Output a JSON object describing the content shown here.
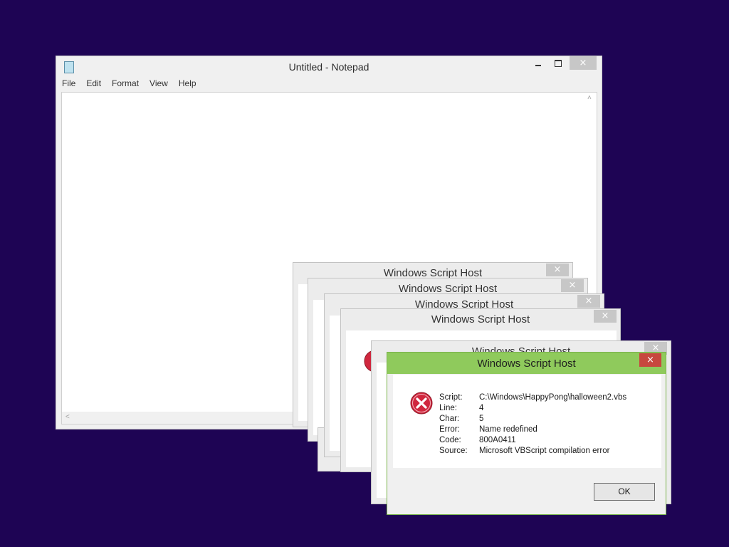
{
  "notepad": {
    "title": "Untitled - Notepad",
    "menu": [
      "File",
      "Edit",
      "Format",
      "View",
      "Help"
    ],
    "close_symbol": "×",
    "scroll_up_symbol": "˄",
    "scroll_left_symbol": "˂"
  },
  "background_windows": {
    "title": "Windows Script Host",
    "close_symbol": "×"
  },
  "error_dialog": {
    "title": "Windows Script Host",
    "close_symbol": "×",
    "icon": "error-icon",
    "fields": [
      {
        "label": "Script:",
        "value": "C:\\Windows\\HappyPong\\halloween2.vbs"
      },
      {
        "label": "Line:",
        "value": "4"
      },
      {
        "label": "Char:",
        "value": "5"
      },
      {
        "label": "Error:",
        "value": "Name redefined"
      },
      {
        "label": "Code:",
        "value": "800A0411"
      },
      {
        "label": "Source:",
        "value": "Microsoft VBScript compilation error"
      }
    ],
    "ok_label": "OK"
  },
  "colors": {
    "desktop": "#1e0454",
    "active_titlebar": "#8fca5c",
    "close_red": "#c7473e",
    "error_icon_red": "#d0273e"
  }
}
